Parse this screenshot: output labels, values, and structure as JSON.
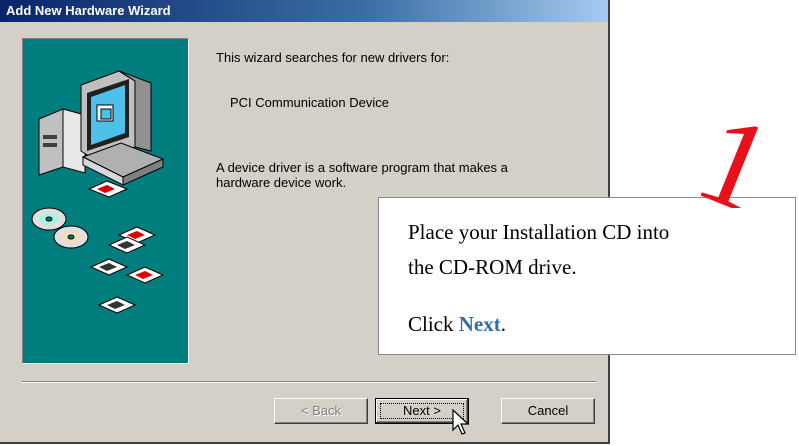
{
  "window": {
    "title": "Add New Hardware Wizard"
  },
  "wizard": {
    "intro": "This wizard searches for new drivers for:",
    "device_name": "PCI Communication Device",
    "description_line1": "A device driver is a software program that makes a",
    "description_line2": "hardware device work."
  },
  "buttons": {
    "back": "< Back",
    "next": "Next >",
    "cancel": "Cancel"
  },
  "callout": {
    "line1": "Place your Installation CD into",
    "line2": "the CD-ROM drive.",
    "click_prefix": "Click ",
    "click_action": "Next",
    "click_suffix": "."
  },
  "step_number": "1",
  "colors": {
    "title_bar": "#0a246a",
    "illustration_bg": "#007e7e",
    "step_number": "#e8101a",
    "callout_accent": "#2f6fa8",
    "dialog_face": "#d4d0c8"
  }
}
